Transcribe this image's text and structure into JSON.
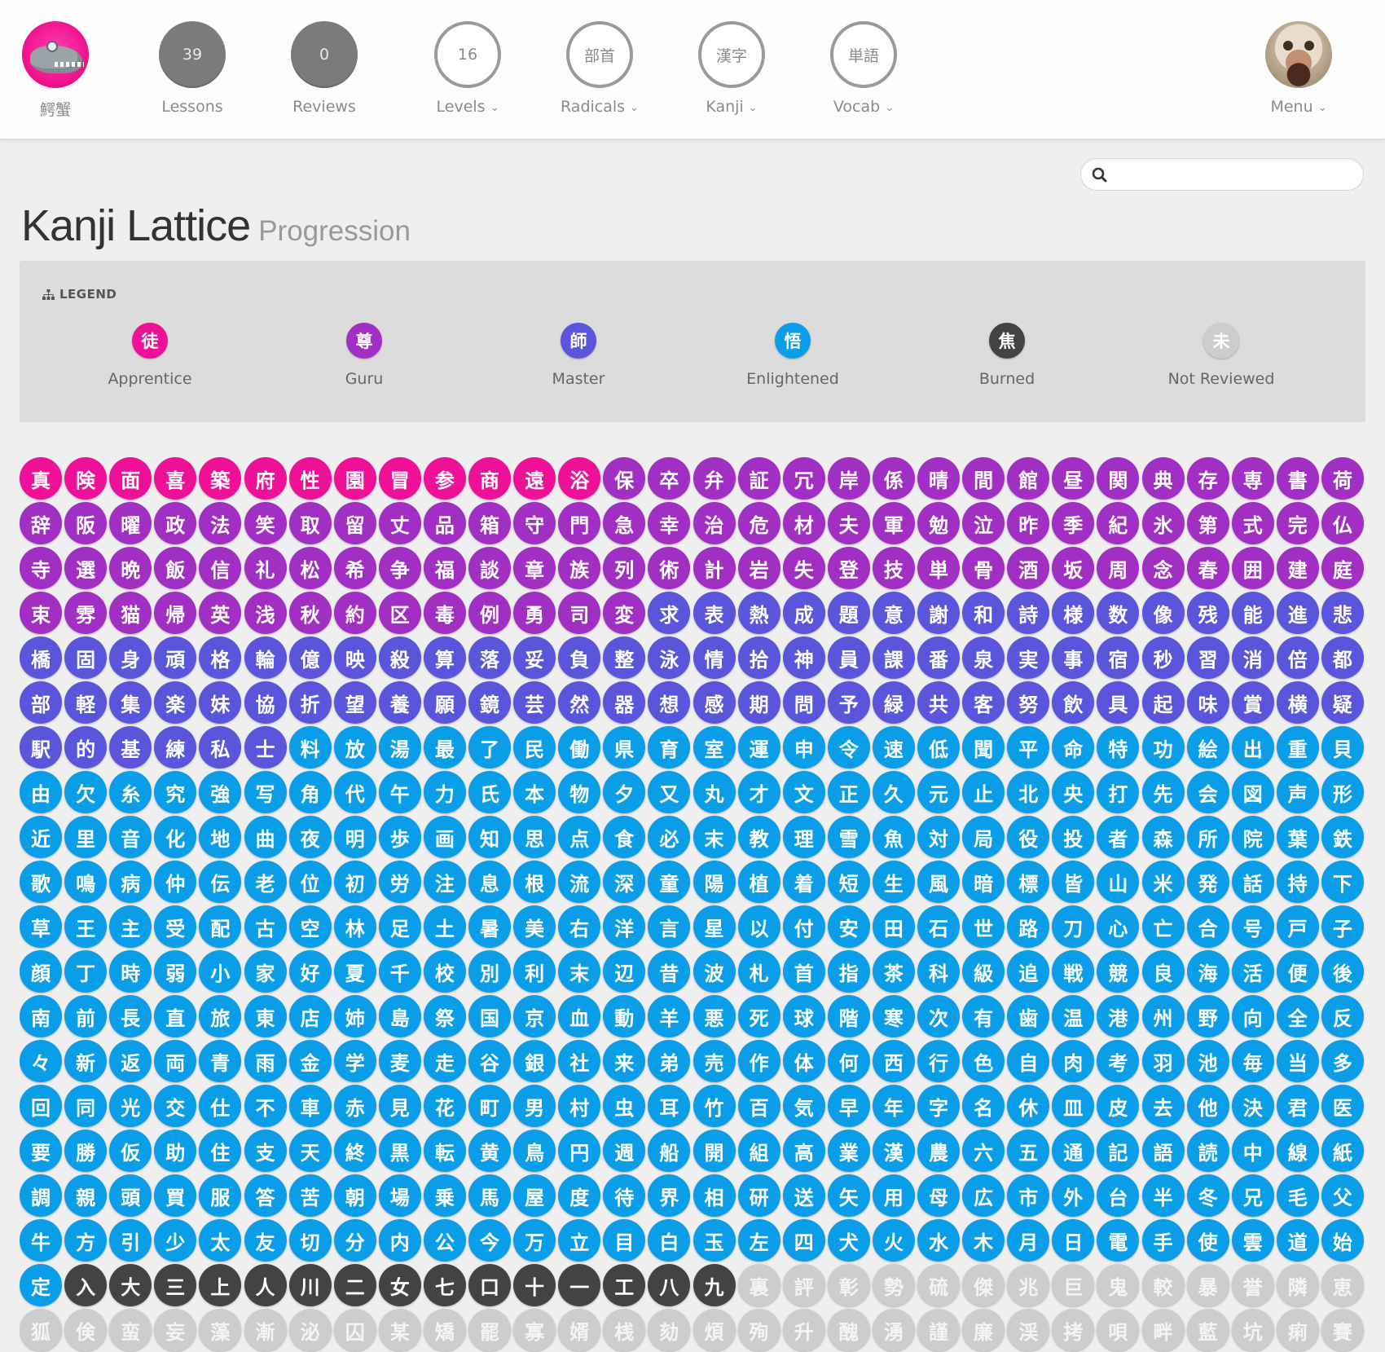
{
  "colors": {
    "apprentice": "#ee1096",
    "guru": "#a12fc4",
    "master": "#5a55db",
    "enlightened": "#0a9ee8",
    "burned": "#434343",
    "not_reviewed": "#cdcdcd"
  },
  "nav": {
    "user": {
      "label": "鰐蟹",
      "icon": "alligator-avatar"
    },
    "lessons": {
      "count": "39",
      "label": "Lessons"
    },
    "reviews": {
      "count": "0",
      "label": "Reviews"
    },
    "levels": {
      "value": "16",
      "label": "Levels"
    },
    "radicals": {
      "value": "部首",
      "label": "Radicals"
    },
    "kanji": {
      "value": "漢字",
      "label": "Kanji"
    },
    "vocab": {
      "value": "単語",
      "label": "Vocab"
    },
    "menu": {
      "label": "Menu",
      "icon": "user-photo-avatar"
    }
  },
  "search": {
    "placeholder": "",
    "value": "",
    "icon": "search-icon"
  },
  "title": {
    "main": "Kanji Lattice",
    "sub": "Progression"
  },
  "legend": {
    "heading": "LEGEND",
    "items": [
      {
        "char": "徒",
        "label": "Apprentice",
        "key": "apprentice"
      },
      {
        "char": "尊",
        "label": "Guru",
        "key": "guru"
      },
      {
        "char": "師",
        "label": "Master",
        "key": "master"
      },
      {
        "char": "悟",
        "label": "Enlightened",
        "key": "enlightened"
      },
      {
        "char": "焦",
        "label": "Burned",
        "key": "burned"
      },
      {
        "char": "未",
        "label": "Not Reviewed",
        "key": "not_reviewed"
      }
    ]
  },
  "lattice": {
    "rows": [
      "真険面喜築府性園冒参商遠浴保卒弁証冗岸係晴間館昼関典存専書荷",
      "辞阪曜政法笑取留丈品箱守門急幸治危材夫軍勉泣昨季紀氷第式完仏",
      "寺選晩飯信礼松希争福談章族列術計岩失登技単骨酒坂周念春囲建庭",
      "束雰猫帰英浅秋約区毒例勇司変求表熱成題意謝和詩様数像残能進悲",
      "橋固身頑格輪億映殺算落妥負整泳情拾神員課番泉実事宿秒習消倍都",
      "部軽集楽妹協折望養願鏡芸然器想感期問予緑共客努飲具起味賞横疑",
      "駅的基練私士料放湯最了民働県育室運申令速低聞平命特功絵出重貝",
      "由欠糸究強写角代午力氏本物夕又丸才文正久元止北央打先会図声形",
      "近里音化地曲夜明歩画知思点食必末教理雪魚対局役投者森所院葉鉄",
      "歌鳴病仲伝老位初労注息根流深童陽植着短生風暗標皆山米発話持下",
      "草王主受配古空林足土暑美右洋言星以付安田石世路刀心亡合号戸子",
      "顔丁時弱小家好夏千校別利末辺昔波札首指茶科級追戦競良海活便後",
      "南前長直旅東店姉島祭国京血動羊悪死球階寒次有歯温港州野向全反",
      "々新返両青雨金学麦走谷銀社来弟売作体何西行色自肉考羽池毎当多",
      "回同光交仕不車赤見花町男村虫耳竹百気早年字名休皿皮去他決君医",
      "要勝仮助住支天終黒転黄鳥円週船開組高業漢農六五通記語読中線紙",
      "調親頭買服答苦朝場乗馬屋度待界相研送矢用母広市外台半冬兄毛父",
      "牛方引少太友切分内公今万立目白玉左四犬火水木月日電手使雲道始",
      "定入大三上人川二女七口十一工八九裏評彰勢硫傑兆巨鬼較暴誉隣恵",
      "狐倹蛮妄藻漸泌囚某矯罷寡婿桟劾煩殉升醜湧謹廉渓拷唄畔藍坑痢賽"
    ],
    "status_runs": [
      [
        [
          "apprentice",
          13
        ],
        [
          "guru",
          17
        ]
      ],
      [
        [
          "guru",
          30
        ]
      ],
      [
        [
          "guru",
          30
        ]
      ],
      [
        [
          "guru",
          14
        ],
        [
          "master",
          16
        ]
      ],
      [
        [
          "master",
          30
        ]
      ],
      [
        [
          "master",
          30
        ]
      ],
      [
        [
          "master",
          6
        ],
        [
          "enlightened",
          24
        ]
      ],
      [
        [
          "enlightened",
          30
        ]
      ],
      [
        [
          "enlightened",
          30
        ]
      ],
      [
        [
          "enlightened",
          30
        ]
      ],
      [
        [
          "enlightened",
          30
        ]
      ],
      [
        [
          "enlightened",
          30
        ]
      ],
      [
        [
          "enlightened",
          30
        ]
      ],
      [
        [
          "enlightened",
          30
        ]
      ],
      [
        [
          "enlightened",
          30
        ]
      ],
      [
        [
          "enlightened",
          30
        ]
      ],
      [
        [
          "enlightened",
          30
        ]
      ],
      [
        [
          "enlightened",
          30
        ]
      ],
      [
        [
          "enlightened",
          1
        ],
        [
          "burned",
          15
        ],
        [
          "not_reviewed",
          14
        ]
      ],
      [
        [
          "not_reviewed",
          30
        ]
      ]
    ]
  }
}
